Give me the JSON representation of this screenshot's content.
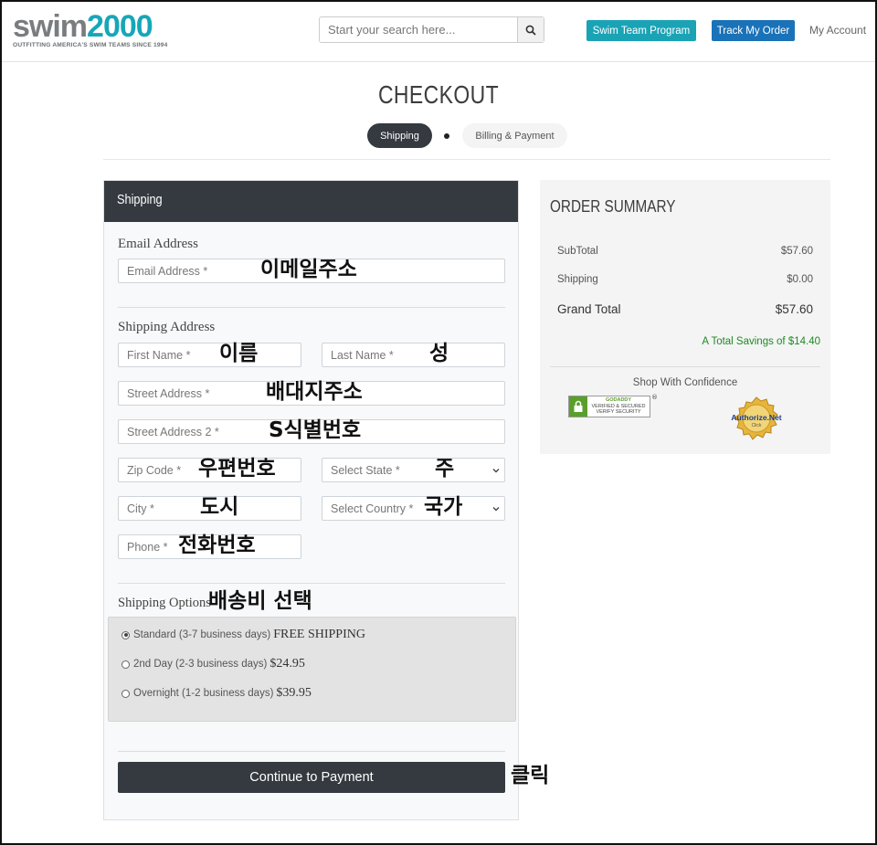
{
  "header": {
    "logo_main": "swim",
    "logo_num": "2000",
    "logo_tagline": "OUTFITTING AMERICA'S SWIM TEAMS SINCE 1994",
    "search_placeholder": "Start your search here...",
    "btn_swim_team": "Swim Team Program",
    "btn_track_order": "Track My Order",
    "my_account": "My Account",
    "colors": {
      "teal": "#1aa3b5",
      "blue": "#1a72b8"
    }
  },
  "checkout": {
    "title": "CHECKOUT",
    "steps": [
      "Shipping",
      "Billing & Payment"
    ]
  },
  "form": {
    "panel_title": "Shipping",
    "email_section": "Email Address",
    "email_placeholder": "Email Address *",
    "shipping_section": "Shipping Address",
    "first_name": "First Name *",
    "last_name": "Last Name *",
    "street": "Street Address *",
    "street2": "Street Address 2 *",
    "zip": "Zip Code *",
    "state": "Select State *",
    "city": "City *",
    "country": "Select Country *",
    "phone": "Phone *",
    "options_section": "Shipping Options",
    "options": [
      {
        "label": "Standard (3-7 business days)",
        "price": "FREE SHIPPING",
        "selected": true
      },
      {
        "label": "2nd Day (2-3 business days)",
        "price": "$24.95",
        "selected": false
      },
      {
        "label": "Overnight (1-2 business days)",
        "price": "$39.95",
        "selected": false
      }
    ],
    "continue": "Continue to Payment"
  },
  "annotations": {
    "email": "이메일주소",
    "first": "이름",
    "last": "성",
    "street": "배대지주소",
    "street2": "S식별번호",
    "zip": "우편번호",
    "state": "주",
    "city": "도시",
    "country": "국가",
    "phone": "전화번호",
    "options": "배송비 선택",
    "click": "클릭"
  },
  "summary": {
    "title": "ORDER SUMMARY",
    "subtotal_label": "SubTotal",
    "subtotal": "$57.60",
    "shipping_label": "Shipping",
    "shipping": "$0.00",
    "grand_label": "Grand Total",
    "grand": "$57.60",
    "savings": "A Total Savings of $14.40",
    "confidence": "Shop With Confidence",
    "godaddy_1": "GODADDY",
    "godaddy_2": "VERIFIED & SECURED",
    "godaddy_3": "VERIFY SECURITY",
    "authnet": "Authorize.Net",
    "authnet_click": "Click"
  }
}
